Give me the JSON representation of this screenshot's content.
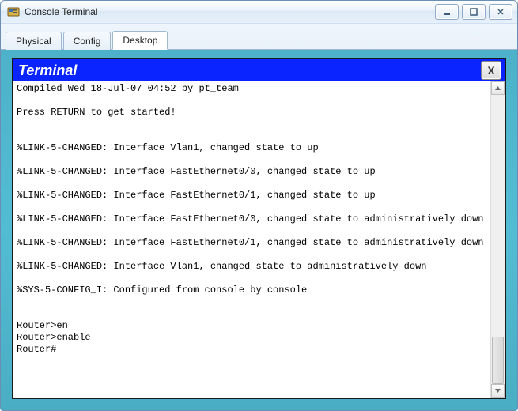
{
  "window": {
    "title": "Console Terminal"
  },
  "tabs": [
    {
      "label": "Physical"
    },
    {
      "label": "Config"
    },
    {
      "label": "Desktop"
    }
  ],
  "terminal": {
    "header": "Terminal",
    "close_label": "X",
    "lines": [
      "Compiled Wed 18-Jul-07 04:52 by pt_team",
      "",
      "Press RETURN to get started!",
      "",
      "",
      "%LINK-5-CHANGED: Interface Vlan1, changed state to up",
      "",
      "%LINK-5-CHANGED: Interface FastEthernet0/0, changed state to up",
      "",
      "%LINK-5-CHANGED: Interface FastEthernet0/1, changed state to up",
      "",
      "%LINK-5-CHANGED: Interface FastEthernet0/0, changed state to administratively down",
      "",
      "%LINK-5-CHANGED: Interface FastEthernet0/1, changed state to administratively down",
      "",
      "%LINK-5-CHANGED: Interface Vlan1, changed state to administratively down",
      "",
      "%SYS-5-CONFIG_I: Configured from console by console",
      "",
      "",
      "Router>en",
      "Router>enable",
      "Router#"
    ]
  }
}
